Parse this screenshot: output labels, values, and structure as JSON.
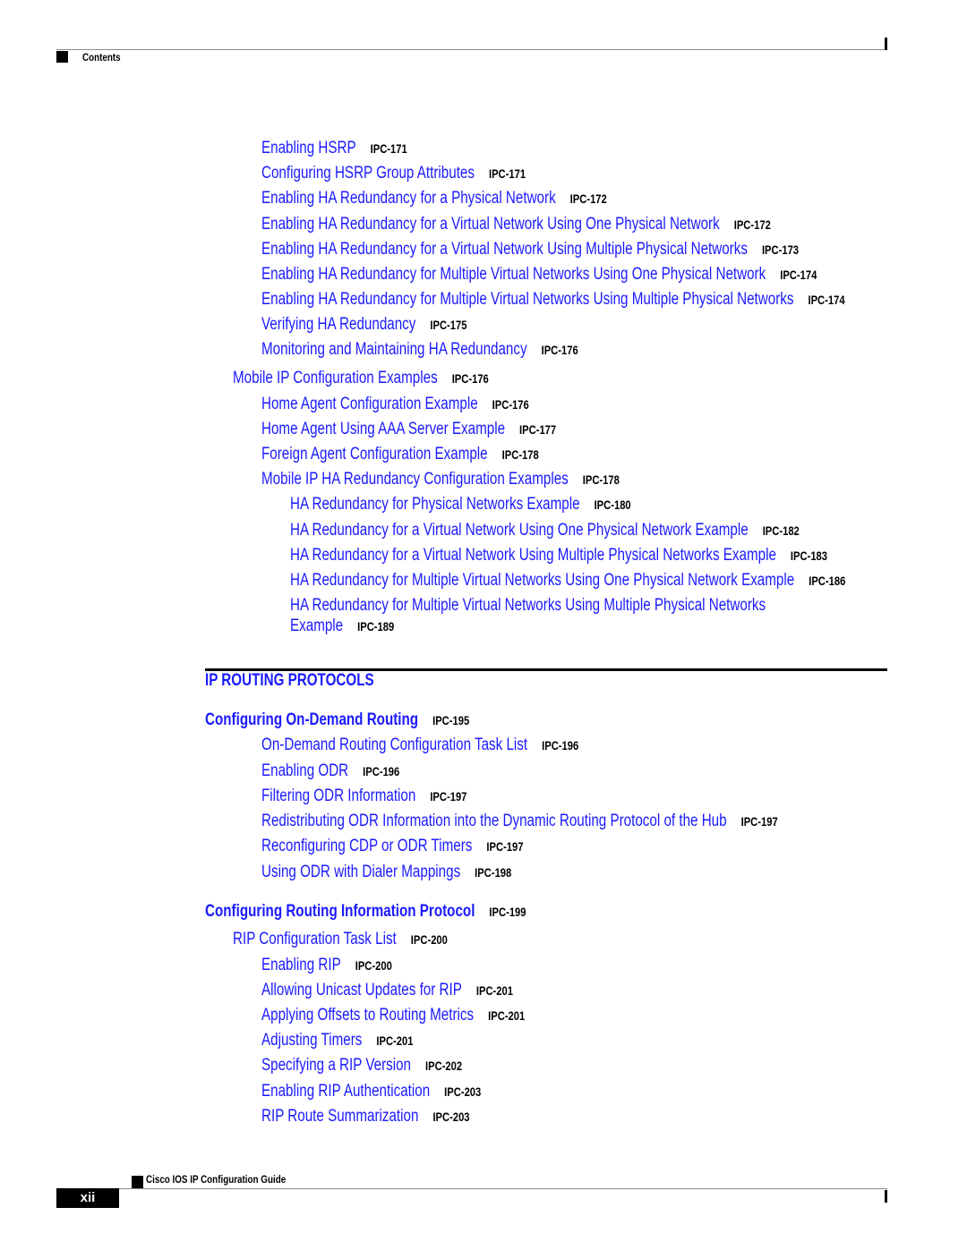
{
  "header": {
    "section_label": "Contents"
  },
  "toc_top": [
    {
      "level": 2,
      "title": "Enabling HSRP",
      "page": "IPC-171"
    },
    {
      "level": 2,
      "title": "Configuring HSRP Group Attributes",
      "page": "IPC-171"
    },
    {
      "level": 2,
      "title": "Enabling HA Redundancy for a Physical Network",
      "page": "IPC-172"
    },
    {
      "level": 2,
      "title": "Enabling HA Redundancy for a Virtual Network Using One Physical Network",
      "page": "IPC-172"
    },
    {
      "level": 2,
      "title": "Enabling HA Redundancy for a Virtual Network Using Multiple Physical Networks",
      "page": "IPC-173"
    },
    {
      "level": 2,
      "title": "Enabling HA Redundancy for Multiple Virtual Networks Using One Physical Network",
      "page": "IPC-174"
    },
    {
      "level": 2,
      "title": "Enabling HA Redundancy for Multiple Virtual Networks Using Multiple Physical Networks",
      "page": "IPC-174"
    },
    {
      "level": 2,
      "title": "Verifying HA Redundancy",
      "page": "IPC-175"
    },
    {
      "level": 2,
      "title": "Monitoring and Maintaining HA Redundancy",
      "page": "IPC-176"
    },
    {
      "level": 1,
      "title": "Mobile IP Configuration Examples",
      "page": "IPC-176"
    },
    {
      "level": 2,
      "title": "Home Agent Configuration Example",
      "page": "IPC-176"
    },
    {
      "level": 2,
      "title": "Home Agent Using AAA Server Example",
      "page": "IPC-177"
    },
    {
      "level": 2,
      "title": "Foreign Agent Configuration Example",
      "page": "IPC-178"
    },
    {
      "level": 2,
      "title": "Mobile IP HA Redundancy Configuration Examples",
      "page": "IPC-178"
    },
    {
      "level": 3,
      "title": "HA Redundancy for Physical Networks Example",
      "page": "IPC-180"
    },
    {
      "level": 3,
      "title": "HA Redundancy for a Virtual Network Using One Physical Network Example",
      "page": "IPC-182"
    },
    {
      "level": 3,
      "title": "HA Redundancy for a Virtual Network Using Multiple Physical Networks Example",
      "page": "IPC-183"
    },
    {
      "level": 3,
      "title": "HA Redundancy for Multiple Virtual Networks Using One Physical Network Example",
      "page": "IPC-186"
    }
  ],
  "toc_wrapped": {
    "title_line1": "HA Redundancy for Multiple Virtual Networks Using Multiple Physical Networks",
    "title_line2": "Example",
    "page": "IPC-189"
  },
  "part": {
    "title": "IP ROUTING PROTOCOLS"
  },
  "odr": {
    "chapter": {
      "title": "Configuring On-Demand Routing",
      "page": "IPC-195"
    },
    "entries": [
      {
        "level": 2,
        "title": "On-Demand Routing Configuration Task List",
        "page": "IPC-196"
      },
      {
        "level": 2,
        "title": "Enabling ODR",
        "page": "IPC-196"
      },
      {
        "level": 2,
        "title": "Filtering ODR Information",
        "page": "IPC-197"
      },
      {
        "level": 2,
        "title": "Redistributing ODR Information into the Dynamic Routing Protocol of the Hub",
        "page": "IPC-197"
      },
      {
        "level": 2,
        "title": "Reconfiguring CDP or ODR Timers",
        "page": "IPC-197"
      },
      {
        "level": 2,
        "title": "Using ODR with Dialer Mappings",
        "page": "IPC-198"
      }
    ]
  },
  "rip": {
    "chapter": {
      "title": "Configuring Routing Information Protocol",
      "page": "IPC-199"
    },
    "entries": [
      {
        "level": 1,
        "title": "RIP Configuration Task List",
        "page": "IPC-200"
      },
      {
        "level": 2,
        "title": "Enabling RIP",
        "page": "IPC-200"
      },
      {
        "level": 2,
        "title": "Allowing Unicast Updates for RIP",
        "page": "IPC-201"
      },
      {
        "level": 2,
        "title": "Applying Offsets to Routing Metrics",
        "page": "IPC-201"
      },
      {
        "level": 2,
        "title": "Adjusting Timers",
        "page": "IPC-201"
      },
      {
        "level": 2,
        "title": "Specifying a RIP Version",
        "page": "IPC-202"
      },
      {
        "level": 2,
        "title": "Enabling RIP Authentication",
        "page": "IPC-203"
      },
      {
        "level": 2,
        "title": "RIP Route Summarization",
        "page": "IPC-203"
      }
    ]
  },
  "footer": {
    "book_title": "Cisco IOS IP Configuration Guide",
    "page_number": "xii"
  }
}
